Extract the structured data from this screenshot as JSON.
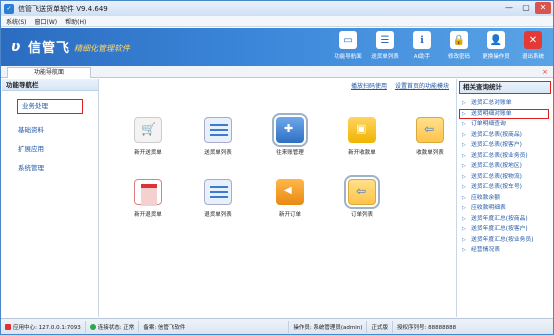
{
  "window": {
    "title": "信管飞送货单软件 V9.4.649",
    "minimize_label": "—",
    "restore_label": "▢",
    "close_label": "✕"
  },
  "menu": [
    "系统(S)",
    "窗口(W)",
    "帮助(H)"
  ],
  "banner": {
    "logo_text": "信管飞",
    "slogan": "精细化管理软件",
    "tools": [
      {
        "label": "功能导航面",
        "icon": "monitor-icon"
      },
      {
        "label": "送货单列表",
        "icon": "list-icon"
      },
      {
        "label": "AI助手",
        "icon": "info-icon"
      },
      {
        "label": "修改密码",
        "icon": "lock-icon"
      },
      {
        "label": "更换操作员",
        "icon": "user-icon"
      },
      {
        "label": "退出系统",
        "icon": "exit-icon"
      }
    ]
  },
  "tab": {
    "label": "功能导航面",
    "close": "×"
  },
  "leftnav": {
    "header": "功能导航栏",
    "items": [
      "业务处理",
      "基础资料",
      "扩展应用",
      "系统管理"
    ]
  },
  "center": {
    "links": [
      "播放扫码使用",
      "设置首页的功能模块"
    ],
    "functions": [
      {
        "label": "新开送货单",
        "icon": "cart-icon"
      },
      {
        "label": "送货单列表",
        "icon": "list-icon"
      },
      {
        "label": "往来账管理",
        "icon": "add-icon"
      },
      {
        "label": "新开收款单",
        "icon": "box-icon"
      },
      {
        "label": "收款单列表",
        "icon": "card-icon"
      },
      {
        "label": "新开退货单",
        "icon": "doc-icon"
      },
      {
        "label": "退货单列表",
        "icon": "list-icon"
      },
      {
        "label": "新开订单",
        "icon": "back-arrow-icon"
      },
      {
        "label": "订单列表",
        "icon": "order-list-icon"
      }
    ]
  },
  "rightpanel": {
    "header": "相关查询统计",
    "items": [
      "送货汇总对账单",
      "送货明细对账单",
      "订单明细查询",
      "送货汇总表(按商品)",
      "送货汇总表(按客户)",
      "送货汇总表(按业务员)",
      "送货汇总表(按地区)",
      "送货汇总表(按物流)",
      "送货汇总表(按车号)",
      "应收款余额",
      "应收款明细表",
      "送货年度汇总(按商品)",
      "送货年度汇总(按客户)",
      "送货年度汇总(按业务员)",
      "经营情况表"
    ]
  },
  "statusbar": {
    "app_center": "应用中心: 127.0.0.1:7093",
    "connection": "连接状态: 正常",
    "note": "备案: 信管飞软件",
    "operator": "操作员: 系统管理员(admin)",
    "version": "正式版",
    "serial": "授权序列号: 88888888"
  },
  "colors": {
    "banner": "#3b86d9",
    "highlight_border": "#e02020",
    "link": "#1f57a6"
  }
}
